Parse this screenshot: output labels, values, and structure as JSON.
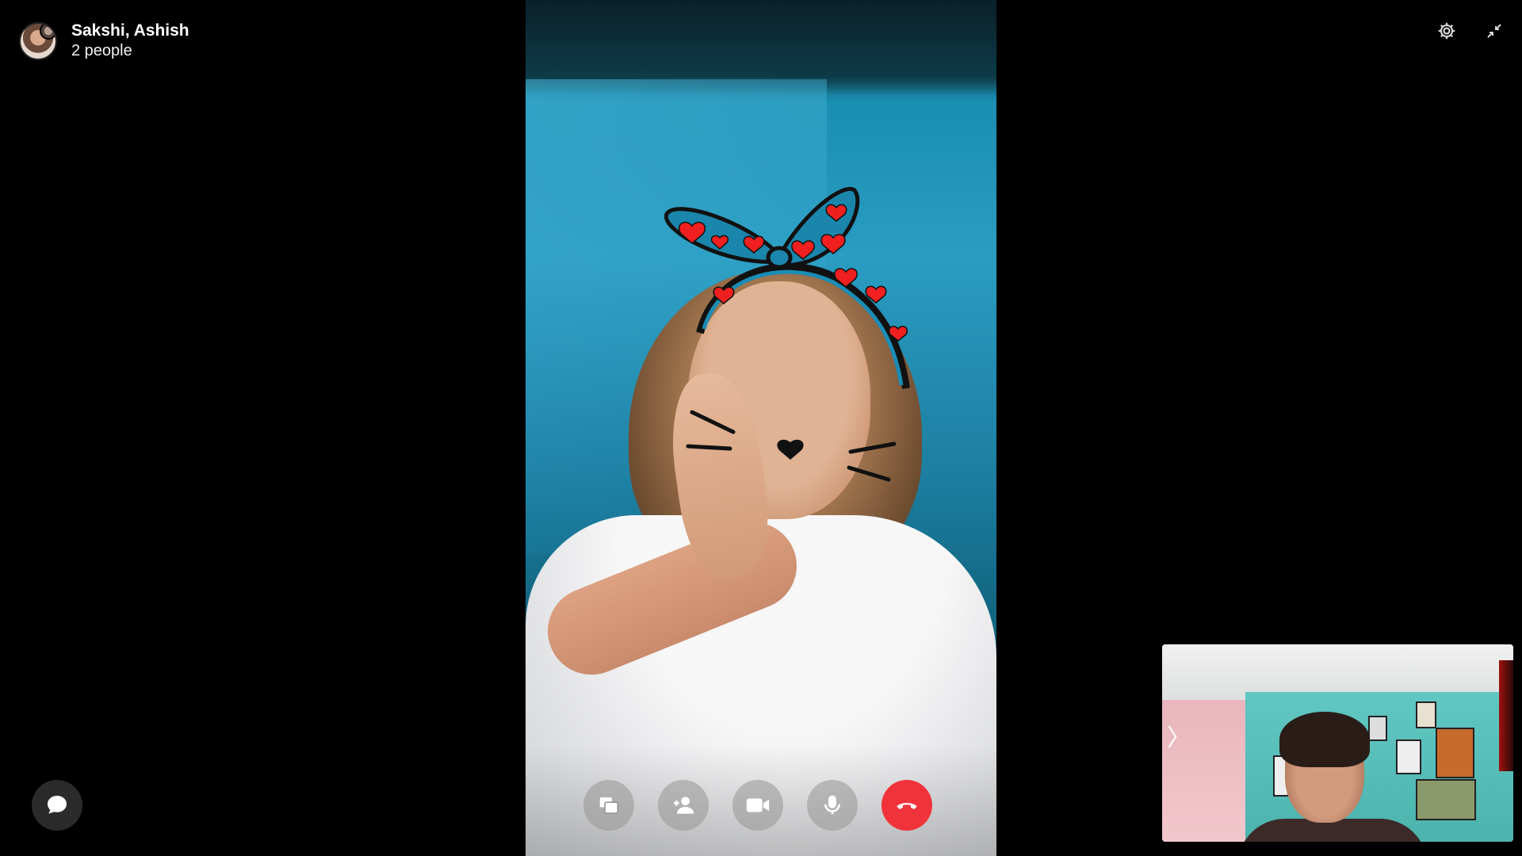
{
  "call": {
    "title": "Sakshi, Ashish",
    "participants_label": "2 people"
  },
  "icons": {
    "settings": "gear-icon",
    "minimize": "minimize-arrows-icon",
    "chat": "chat-bubble-icon",
    "share_screen": "share-screen-icon",
    "add_person": "add-person-icon",
    "video": "video-camera-icon",
    "mic": "microphone-icon",
    "end_call": "end-call-icon",
    "self_view_chevron": "chevron-right-icon"
  },
  "self_view": {
    "chevron": "〉"
  },
  "colors": {
    "background": "#000000",
    "end_call": "#f0333a",
    "control_button": "#969696"
  }
}
